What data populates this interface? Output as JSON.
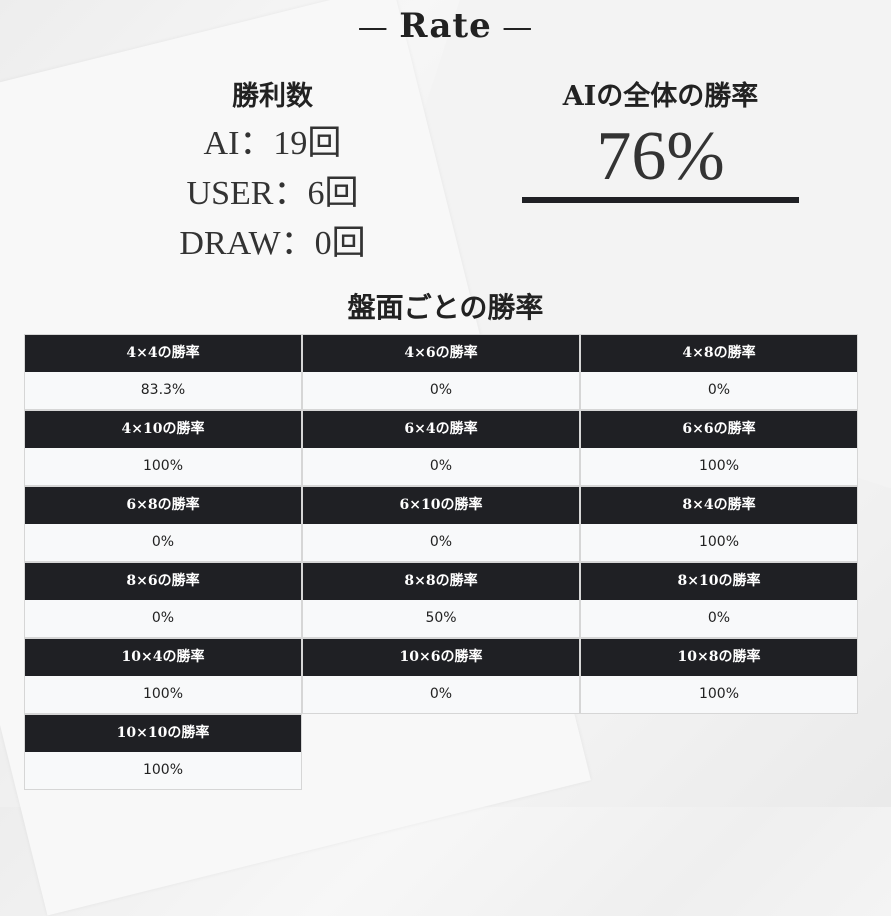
{
  "title": "Rate",
  "wins": {
    "heading": "勝利数",
    "ai": "AI：19回",
    "user": "USER：6回",
    "draw": "DRAW：0回"
  },
  "overall": {
    "heading": "AIの全体の勝率",
    "rate": "76%"
  },
  "board_section": {
    "heading": "盤面ごとの勝率",
    "items": [
      {
        "label": "4×4の勝率",
        "value": "83.3%"
      },
      {
        "label": "4×6の勝率",
        "value": "0%"
      },
      {
        "label": "4×8の勝率",
        "value": "0%"
      },
      {
        "label": "4×10の勝率",
        "value": "100%"
      },
      {
        "label": "6×4の勝率",
        "value": "0%"
      },
      {
        "label": "6×6の勝率",
        "value": "100%"
      },
      {
        "label": "6×8の勝率",
        "value": "0%"
      },
      {
        "label": "6×10の勝率",
        "value": "0%"
      },
      {
        "label": "8×4の勝率",
        "value": "100%"
      },
      {
        "label": "8×6の勝率",
        "value": "0%"
      },
      {
        "label": "8×8の勝率",
        "value": "50%"
      },
      {
        "label": "8×10の勝率",
        "value": "0%"
      },
      {
        "label": "10×4の勝率",
        "value": "100%"
      },
      {
        "label": "10×6の勝率",
        "value": "0%"
      },
      {
        "label": "10×8の勝率",
        "value": "100%"
      },
      {
        "label": "10×10の勝率",
        "value": "100%"
      }
    ]
  }
}
